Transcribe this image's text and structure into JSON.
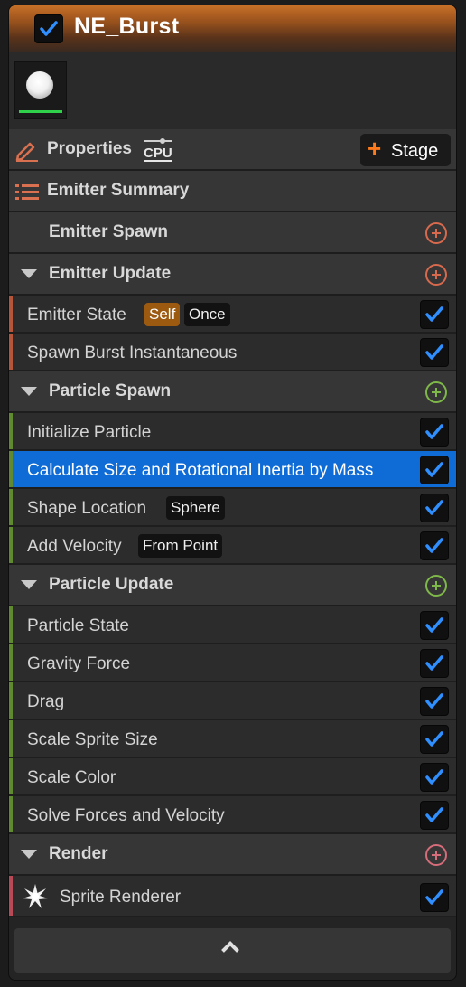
{
  "title": "NE_Burst",
  "colors": {
    "emitter_accent": "#c0553a",
    "spawn_accent": "#5f8a30",
    "update_accent": "#5f8a30",
    "render_accent": "#b84a58",
    "selected": "#0f6bd6",
    "check": "#2f8fff"
  },
  "toolbar": {
    "properties_label": "Properties",
    "cpu_label": "CPU",
    "stage_label": "Stage"
  },
  "summary_label": "Emitter Summary",
  "emitter_spawn_label": "Emitter Spawn",
  "emitter_update": {
    "label": "Emitter Update",
    "items": [
      {
        "label": "Emitter State",
        "tags": [
          "Self",
          "Once"
        ],
        "checked": true
      },
      {
        "label": "Spawn Burst Instantaneous",
        "checked": true
      }
    ]
  },
  "particle_spawn": {
    "label": "Particle Spawn",
    "items": [
      {
        "label": "Initialize Particle",
        "checked": true
      },
      {
        "label": "Calculate Size and Rotational Inertia by Mass",
        "checked": true,
        "selected": true
      },
      {
        "label": "Shape Location",
        "tag": "Sphere",
        "checked": true
      },
      {
        "label": "Add Velocity",
        "tag": "From Point",
        "checked": true
      }
    ]
  },
  "particle_update": {
    "label": "Particle Update",
    "items": [
      {
        "label": "Particle State",
        "checked": true
      },
      {
        "label": "Gravity Force",
        "checked": true
      },
      {
        "label": "Drag",
        "checked": true
      },
      {
        "label": "Scale Sprite Size",
        "checked": true
      },
      {
        "label": "Scale Color",
        "checked": true
      },
      {
        "label": "Solve Forces and Velocity",
        "checked": true
      }
    ]
  },
  "render": {
    "label": "Render",
    "items": [
      {
        "label": "Sprite Renderer",
        "checked": true
      }
    ]
  },
  "icons": {
    "title_checkbox": "checkbox-checked-icon",
    "properties": "pencil-icon",
    "cpu": "cpu-icon",
    "summary": "list-icon",
    "collapse": "chevron-up-icon",
    "sprite": "sprite-star-icon"
  }
}
